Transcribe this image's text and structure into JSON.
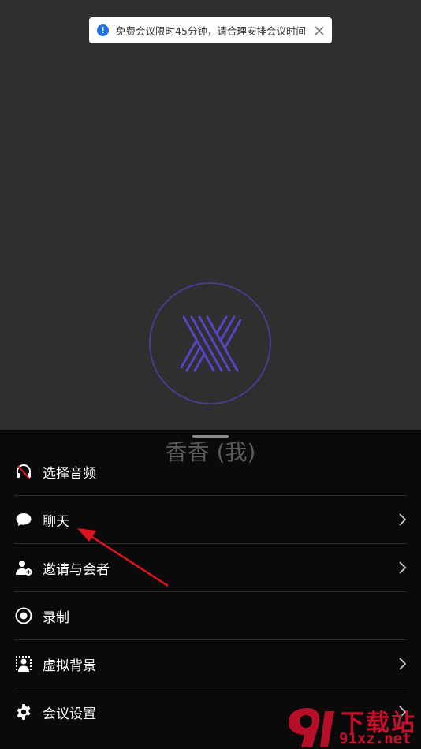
{
  "toast": {
    "message": "免费会议限时45分钟，请合理安排会议时间",
    "info_glyph": "!"
  },
  "participant": {
    "name": "香香 (我)"
  },
  "menu": {
    "items": [
      {
        "label": "选择音频",
        "icon": "headset-muted-icon",
        "has_chevron": false
      },
      {
        "label": "聊天",
        "icon": "chat-bubble-icon",
        "has_chevron": true
      },
      {
        "label": "邀请与会者",
        "icon": "add-user-icon",
        "has_chevron": true
      },
      {
        "label": "录制",
        "icon": "record-icon",
        "has_chevron": false
      },
      {
        "label": "虚拟背景",
        "icon": "virtual-background-icon",
        "has_chevron": true
      },
      {
        "label": "会议设置",
        "icon": "gear-icon",
        "has_chevron": true
      }
    ]
  },
  "watermark": {
    "top": "下载站",
    "bottom": "91xz.net"
  },
  "colors": {
    "toast_info": "#1e6fe8",
    "avatar_ring": "#4b3b8e",
    "annotation_arrow": "#e0141e",
    "watermark": "#c8102e"
  }
}
